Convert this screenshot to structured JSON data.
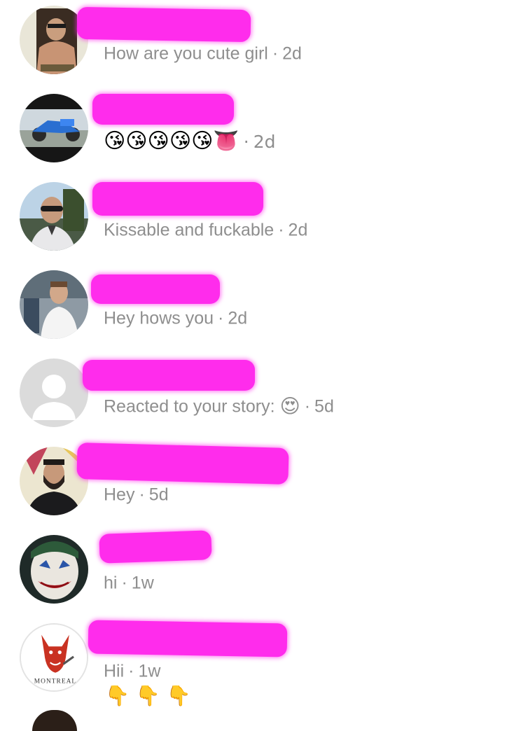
{
  "threads": [
    {
      "avatar": "shirtless-man-photo",
      "message": "How are you cute girl",
      "time": "2d"
    },
    {
      "avatar": "motorcycle-photo",
      "emojis": "😘😘😘😘😘👅",
      "time": "2d"
    },
    {
      "avatar": "man-sunglasses-photo",
      "message": "Kissable and fuckable",
      "time": "2d"
    },
    {
      "avatar": "man-white-shirt-photo",
      "message": "Hey hows you",
      "time": "2d"
    },
    {
      "avatar": "default-profile-placeholder",
      "message": "Reacted to your story:",
      "reaction_emoji": "😍",
      "time": "5d"
    },
    {
      "avatar": "bearded-man-photo",
      "message": "Hey",
      "time": "5d"
    },
    {
      "avatar": "joker-face-photo",
      "message": "hi",
      "time": "1w"
    },
    {
      "avatar": "montreal-devil-logo",
      "avatar_text": "MONTREAL",
      "message": "Hii",
      "time": "1w",
      "emojis": "👇 👇 👇"
    }
  ],
  "separator": "·",
  "colors": {
    "redaction": "#ff2cec",
    "message_text": "#8e8e8e",
    "background": "#ffffff"
  }
}
